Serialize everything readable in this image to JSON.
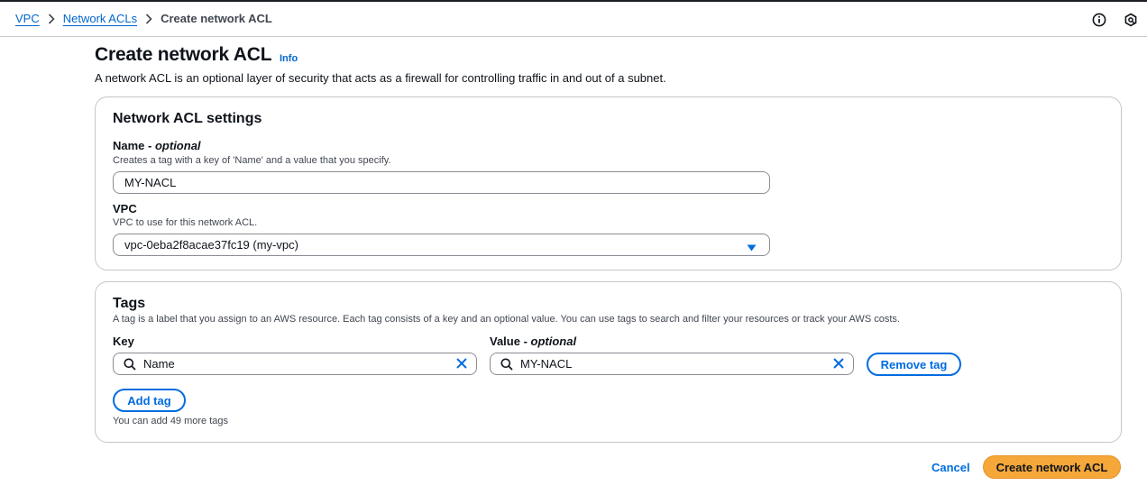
{
  "breadcrumb": {
    "items": [
      {
        "label": "VPC"
      },
      {
        "label": "Network ACLs"
      },
      {
        "label": "Create network ACL"
      }
    ]
  },
  "header_icons": [
    "info-circle-icon",
    "feedback-icon"
  ],
  "page": {
    "title": "Create network ACL",
    "info_link": "Info",
    "description": "A network ACL is an optional layer of security that acts as a firewall for controlling traffic in and out of a subnet."
  },
  "settings": {
    "heading": "Network ACL settings",
    "name_label": "Name",
    "name_optional": "optional",
    "name_hint": "Creates a tag with a key of 'Name' and a value that you specify.",
    "name_value": "MY-NACL",
    "vpc_label": "VPC",
    "vpc_hint": "VPC to use for this network ACL.",
    "vpc_value": "vpc-0eba2f8acae37fc19 (my-vpc)"
  },
  "tags": {
    "heading": "Tags",
    "description": "A tag is a label that you assign to an AWS resource. Each tag consists of a key and an optional value. You can use tags to search and filter your resources or track your AWS costs.",
    "key_label": "Key",
    "value_label": "Value",
    "value_optional": "optional",
    "rows": [
      {
        "key": "Name",
        "value": "MY-NACL"
      }
    ],
    "remove_label": "Remove tag",
    "add_label": "Add tag",
    "limit_note": "You can add 49 more tags"
  },
  "footer": {
    "cancel_label": "Cancel",
    "submit_label": "Create network ACL"
  },
  "colors": {
    "link": "#0066cc",
    "primary_button": "#f6a73a",
    "border": "#c6c6cd"
  }
}
